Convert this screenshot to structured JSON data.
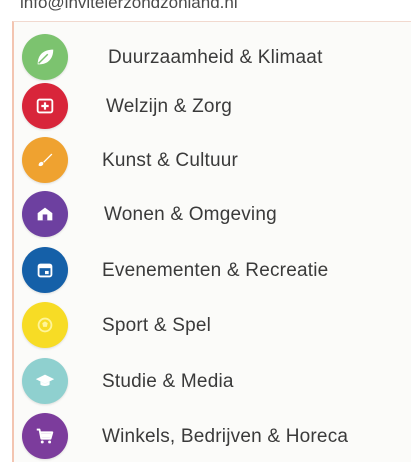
{
  "header": {
    "text": "info@invitelerzondzonland.nl"
  },
  "categories": [
    {
      "label": "Duurzaamheid & Klimaat",
      "color": "#7cc36f",
      "icon": "leaf-icon"
    },
    {
      "label": "Welzijn & Zorg",
      "color": "#d8253a",
      "icon": "first-aid-icon"
    },
    {
      "label": "Kunst & Cultuur",
      "color": "#efa230",
      "icon": "brush-icon"
    },
    {
      "label": "Wonen & Omgeving",
      "color": "#6d40a0",
      "icon": "house-icon"
    },
    {
      "label": "Evenementen & Recreatie",
      "color": "#1560a8",
      "icon": "calendar-icon"
    },
    {
      "label": "Sport & Spel",
      "color": "#f7dc25",
      "icon": "ball-icon"
    },
    {
      "label": "Studie & Media",
      "color": "#8fd0cf",
      "icon": "graduation-cap-icon"
    },
    {
      "label": "Winkels, Bedrijven & Horeca",
      "color": "#7c3c9c",
      "icon": "cart-icon"
    }
  ]
}
